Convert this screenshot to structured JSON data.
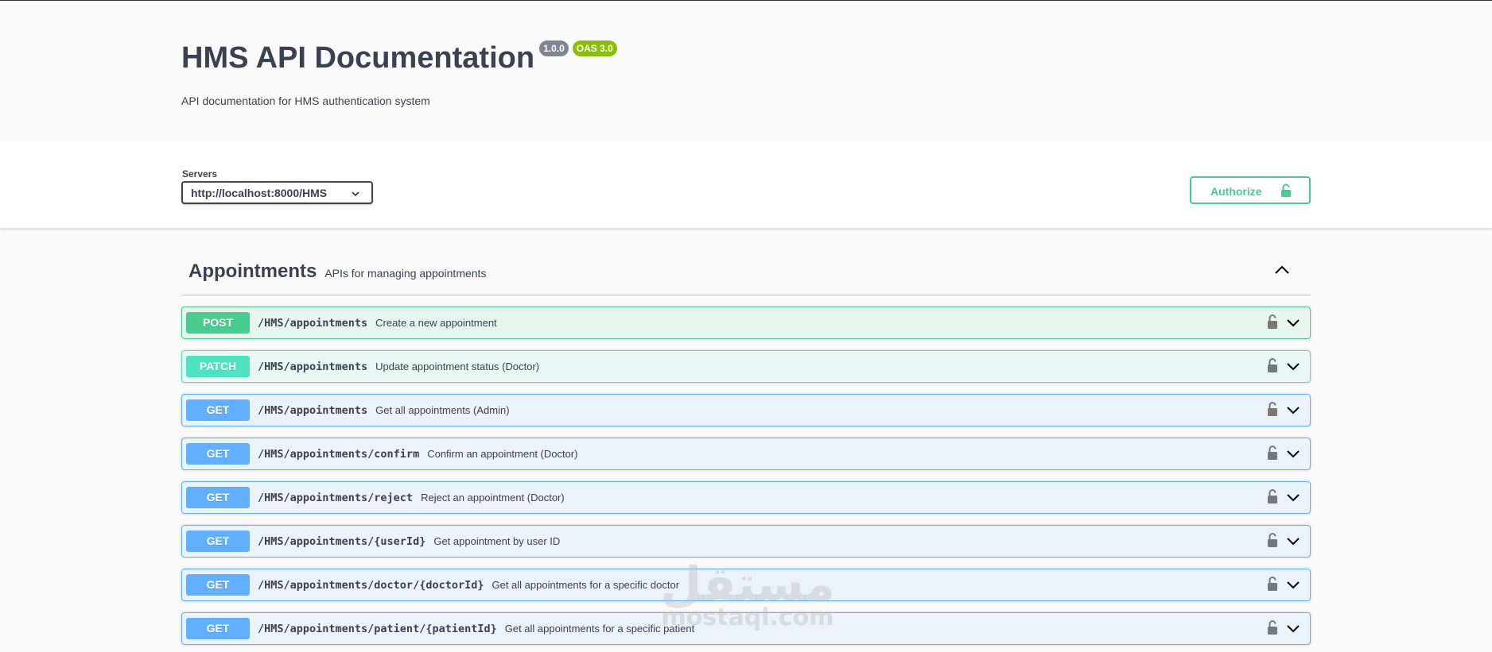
{
  "info": {
    "title": "HMS API Documentation",
    "version": "1.0.0",
    "oas": "OAS 3.0",
    "description": "API documentation for HMS authentication system"
  },
  "servers": {
    "label": "Servers",
    "selected": "http://localhost:8000/HMS"
  },
  "authorize": {
    "label": "Authorize"
  },
  "tag": {
    "name": "Appointments",
    "description": "APIs for managing appointments"
  },
  "operations": [
    {
      "method": "POST",
      "path": "/HMS/appointments",
      "summary": "Create a new appointment"
    },
    {
      "method": "PATCH",
      "path": "/HMS/appointments",
      "summary": "Update appointment status (Doctor)"
    },
    {
      "method": "GET",
      "path": "/HMS/appointments",
      "summary": "Get all appointments (Admin)"
    },
    {
      "method": "GET",
      "path": "/HMS/appointments/confirm",
      "summary": "Confirm an appointment (Doctor)"
    },
    {
      "method": "GET",
      "path": "/HMS/appointments/reject",
      "summary": "Reject an appointment (Doctor)"
    },
    {
      "method": "GET",
      "path": "/HMS/appointments/{userId}",
      "summary": "Get appointment by user ID"
    },
    {
      "method": "GET",
      "path": "/HMS/appointments/doctor/{doctorId}",
      "summary": "Get all appointments for a specific doctor"
    },
    {
      "method": "GET",
      "path": "/HMS/appointments/patient/{patientId}",
      "summary": "Get all appointments for a specific patient"
    }
  ],
  "watermark": {
    "arabic": "مستقل",
    "latin": "mostaql.com"
  },
  "colors": {
    "post": "#49cc90",
    "patch": "#50e3c2",
    "get": "#61affe"
  }
}
